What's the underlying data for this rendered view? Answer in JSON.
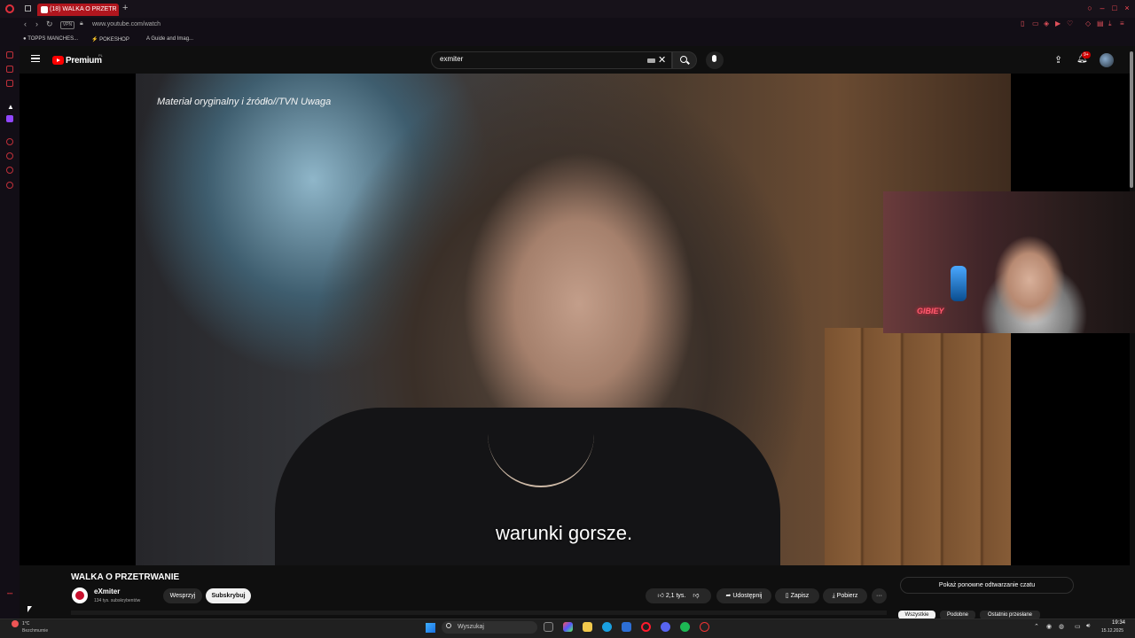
{
  "browser": {
    "tab_title": "(18) WALKA O PRZETR",
    "new_tab": "+",
    "url": "www.youtube.com/watch",
    "vpn": "VPN",
    "bookmarks": [
      "TOPPS MANCHES...",
      "POKESHOP",
      "A Guide and Imag..."
    ]
  },
  "youtube": {
    "logo_text": "Premium",
    "country_code": "PL",
    "search_value": "exmiter",
    "notification_count": "9+"
  },
  "video": {
    "credit_overlay": "Materiał oryginalny i źródło//TVN Uwaga",
    "subtitle": "warunki gorsze.",
    "facecam_sign": "GIBIEY",
    "title": "WALKA O PRZETRWANIE"
  },
  "channel": {
    "name": "eXmiter",
    "subscribers": "134 tys. subskrybentów",
    "join_label": "Wesprzyj",
    "subscribe_label": "Subskrybuj"
  },
  "actions": {
    "likes": "2,1 tys.",
    "share": "Udostępnij",
    "save": "Zapisz",
    "download": "Pobierz",
    "more": "···"
  },
  "chat": {
    "replay_label": "Pokaż ponowne odtwarzanie czatu"
  },
  "chips": [
    "Wszystkie",
    "Podobne",
    "Ostatnio przesłane"
  ],
  "taskbar": {
    "weather_temp": "1°C",
    "weather_desc": "Bezchmurnie",
    "search_placeholder": "Wyszukaj",
    "time": "19:34",
    "date": "15.12.2025"
  },
  "colors": {
    "brand_red": "#ff0000",
    "opera_tab": "#b0161e",
    "yt_background": "#0f0f0f"
  }
}
